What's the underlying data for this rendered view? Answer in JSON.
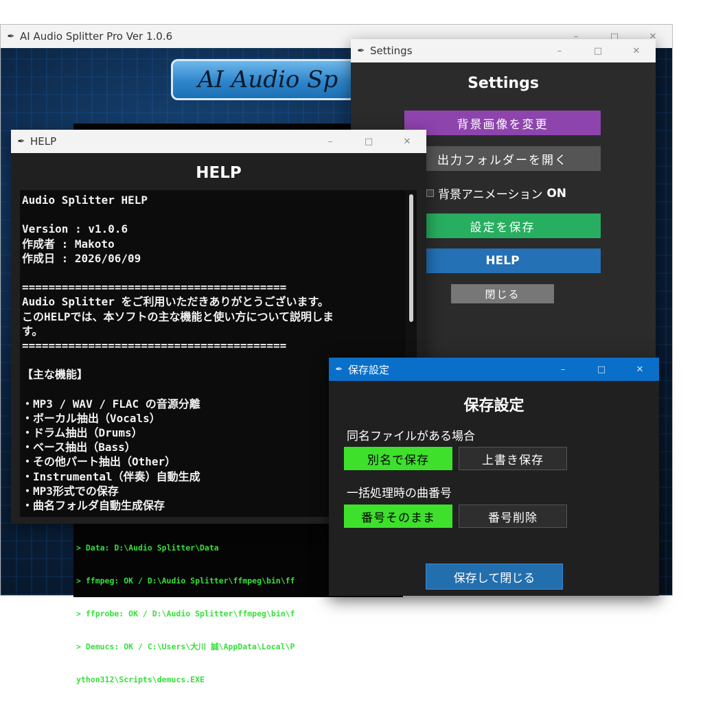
{
  "main_window": {
    "title": "AI Audio Splitter Pro Ver 1.0.6",
    "logo_text": "AI Audio Sp",
    "console_lines": [
      "> Data: D:\\Audio Splitter\\Data",
      "> ffmpeg: OK / D:\\Audio Splitter\\ffmpeg\\bin\\ff",
      "> ffprobe: OK / D:\\Audio Splitter\\ffmpeg\\bin\\f",
      "> Demucs: OK / C:\\Users\\大川 誠\\AppData\\Local\\P",
      "ython312\\Scripts\\demucs.EXE"
    ]
  },
  "settings_window": {
    "title": "Settings",
    "heading": "Settings",
    "change_bg_label": "背景画像を変更",
    "open_folder_label": "出力フォルダーを開く",
    "bg_animation_label": "背景アニメーション",
    "bg_animation_state": "ON",
    "save_settings_label": "設定を保存",
    "help_label": "HELP",
    "close_label": "閉じる"
  },
  "help_window": {
    "title": "HELP",
    "heading": "HELP",
    "lines": [
      "Audio Splitter HELP",
      "",
      "Version : v1.0.6",
      "作成者 : Makoto",
      "作成日 : 2026/06/09",
      "",
      "========================================",
      "Audio Splitter をご利用いただきありがとうございます。",
      "このHELPでは、本ソフトの主な機能と使い方について説明しま",
      "す。",
      "========================================",
      "",
      "【主な機能】",
      "",
      "・MP3 / WAV / FLAC の音源分離",
      "・ボーカル抽出（Vocals）",
      "・ドラム抽出（Drums）",
      "・ベース抽出（Bass）",
      "・その他パート抽出（Other）",
      "・Instrumental（伴奏）自動生成",
      "・MP3形式での保存",
      "・曲名フォルダ自動生成保存"
    ]
  },
  "save_window": {
    "title": "保存設定",
    "heading": "保存設定",
    "same_name_label": "同名ファイルがある場合",
    "rename_label": "別名で保存",
    "overwrite_label": "上書き保存",
    "track_number_label": "一括処理時の曲番号",
    "keep_number_label": "番号そのまま",
    "remove_number_label": "番号削除",
    "save_close_label": "保存して閉じる"
  },
  "colors": {
    "selected_option": "#3ee02c",
    "settings_purple": "#8e44ad",
    "settings_green": "#27ae60",
    "settings_blue": "#2471b5",
    "titlebar_active": "#0a6fc9",
    "console_text": "#35e03a"
  },
  "icons": {
    "window_icon": "feather-icon",
    "minimize": "minimize-icon",
    "maximize": "maximize-icon",
    "close": "close-icon"
  }
}
